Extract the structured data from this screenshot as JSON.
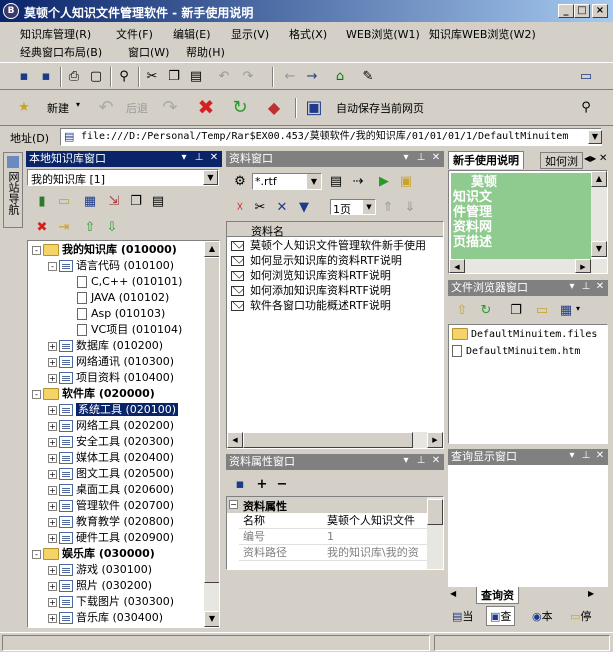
{
  "window": {
    "title": "莫顿个人知识文件管理软件  -  新手使用说明",
    "icon": "app-logo-icon",
    "buttons": [
      "_",
      "□",
      "×"
    ]
  },
  "menu": {
    "row1": [
      "知识库管理(R)",
      "文件(F)",
      "编辑(E)",
      "显示(V)",
      "格式(X)",
      "WEB浏览(W1)",
      "知识库WEB浏览(W2)"
    ],
    "row2": [
      "经典窗口布局(B)",
      "窗口(W)",
      "帮助(H)"
    ]
  },
  "toolbar2": {
    "new_label": "新建",
    "back_label": "后退",
    "autosave_label": "自动保存当前网页"
  },
  "address": {
    "label": "地址(D)",
    "value": "file:///D:/Personal/Temp/Rar$EX00.453/莫顿软件/我的知识库/01/01/01/1/DefaultMinuitem"
  },
  "side_tab": "网站导航",
  "local_panel": {
    "title": "本地知识库窗口",
    "combo": "我的知识库 [1]",
    "tree": [
      {
        "label": "我的知识库 (010000)",
        "level": 0,
        "bold": true,
        "expander": "-"
      },
      {
        "label": "语言代码 (010100)",
        "level": 1,
        "expander": "-"
      },
      {
        "label": "C,C++ (010101)",
        "level": 2,
        "expander": ""
      },
      {
        "label": "JAVA (010102)",
        "level": 2,
        "expander": ""
      },
      {
        "label": "Asp (010103)",
        "level": 2,
        "expander": ""
      },
      {
        "label": "VC项目 (010104)",
        "level": 2,
        "expander": ""
      },
      {
        "label": "数据库 (010200)",
        "level": 1,
        "expander": "+"
      },
      {
        "label": "网络通讯 (010300)",
        "level": 1,
        "expander": "+"
      },
      {
        "label": "项目资料 (010400)",
        "level": 1,
        "expander": "+"
      },
      {
        "label": "软件库 (020000)",
        "level": 0,
        "bold": true,
        "expander": "-"
      },
      {
        "label": "系统工具 (020100)",
        "level": 1,
        "expander": "+",
        "selected": true
      },
      {
        "label": "网络工具 (020200)",
        "level": 1,
        "expander": "+"
      },
      {
        "label": "安全工具 (020300)",
        "level": 1,
        "expander": "+"
      },
      {
        "label": "媒体工具 (020400)",
        "level": 1,
        "expander": "+"
      },
      {
        "label": "图文工具 (020500)",
        "level": 1,
        "expander": "+"
      },
      {
        "label": "桌面工具 (020600)",
        "level": 1,
        "expander": "+"
      },
      {
        "label": "管理软件 (020700)",
        "level": 1,
        "expander": "+"
      },
      {
        "label": "教育教学 (020800)",
        "level": 1,
        "expander": "+"
      },
      {
        "label": "硬件工具 (020900)",
        "level": 1,
        "expander": "+"
      },
      {
        "label": "娱乐库 (030000)",
        "level": 0,
        "bold": true,
        "expander": "-"
      },
      {
        "label": "游戏 (030100)",
        "level": 1,
        "expander": "+"
      },
      {
        "label": "照片 (030200)",
        "level": 1,
        "expander": "+"
      },
      {
        "label": "下载图片 (030300)",
        "level": 1,
        "expander": "+"
      },
      {
        "label": "音乐库 (030400)",
        "level": 1,
        "expander": "+"
      }
    ]
  },
  "material_panel": {
    "title": "资料窗口",
    "filter": "*.rtf",
    "page": "1页",
    "column_header": "资料名",
    "items": [
      "莫顿个人知识文件管理软件新手使用",
      "如何显示知识库的资料RTF说明",
      "如何浏览知识库资料RTF说明",
      "如何添加知识库资料RTF说明",
      "软件各窗口功能概述RTF说明"
    ]
  },
  "property_panel": {
    "title": "资料属性窗口",
    "group": "资料属性",
    "rows": [
      {
        "name": "名称",
        "value": "莫顿个人知识文件"
      },
      {
        "name": "编号",
        "value": "1"
      },
      {
        "name": "资料路径",
        "value": "我的知识库\\我的资"
      }
    ]
  },
  "help_panel": {
    "tabs": [
      "新手使用说明",
      "如何浏"
    ],
    "content_lines": [
      "莫顿",
      "知识文",
      "件管理",
      "资料网",
      "页描述"
    ]
  },
  "file_browser": {
    "title": "文件浏览器窗口",
    "files": [
      "DefaultMinuitem.files",
      "DefaultMinuitem.htm"
    ]
  },
  "query_panel": {
    "title": "查询显示窗口",
    "tab": "查询资"
  },
  "bottom_tabs": [
    "当",
    "查",
    "本",
    "停"
  ],
  "colors": {
    "title_active": "#0a246a",
    "help_bg": "#8fcb8f",
    "selected": "#0a246a"
  }
}
